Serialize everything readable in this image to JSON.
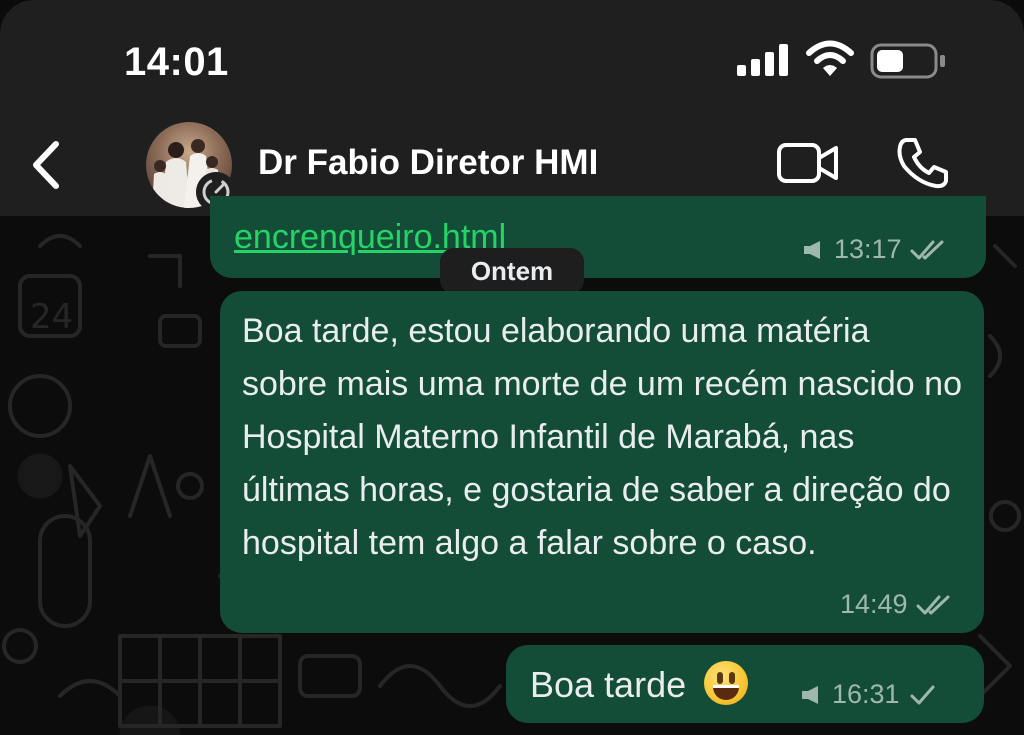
{
  "status_bar": {
    "time": "14:01"
  },
  "header": {
    "contact_name": "Dr Fabio Diretor HMI",
    "icons": [
      "back-chevron-icon",
      "avatar",
      "disappearing-timer-icon",
      "video-call-icon",
      "phone-call-icon"
    ]
  },
  "messages": [
    {
      "link_text": "encrenqueiro.html",
      "time": "13:17",
      "status": "read"
    },
    {
      "text": "Boa tarde, estou elaborando uma matéria sobre mais uma morte de um recém nascido no Hospital Materno Infantil de Marabá, nas últimas horas, e gostaria de saber a direção do hospital tem algo a falar sobre o caso.",
      "time": "14:49",
      "status": "read"
    },
    {
      "text": "Boa tarde",
      "emoji": "smiling-face-icon",
      "time": "16:31",
      "status": "sent"
    }
  ],
  "date_separator": "Ontem",
  "colors": {
    "bubble_out": "#134d37",
    "link": "#25d366",
    "header_bg": "#1f1f1f",
    "chat_bg": "#0c0c0c"
  }
}
